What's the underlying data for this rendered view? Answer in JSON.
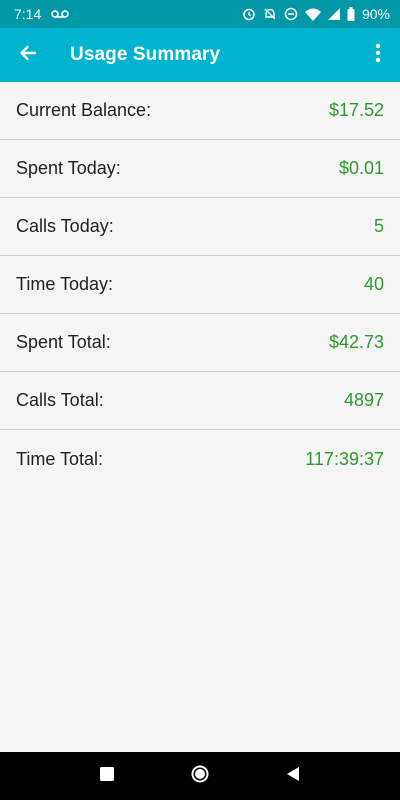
{
  "status_bar": {
    "time": "7:14",
    "battery": "90%",
    "icons": [
      "voicemail-icon",
      "alarm-icon",
      "notifications-off-icon",
      "do-not-disturb-icon",
      "wifi-icon",
      "signal-icon",
      "battery-icon"
    ]
  },
  "app_bar": {
    "title": "Usage Summary",
    "back_icon": "arrow-back-icon",
    "menu_icon": "more-vert-icon"
  },
  "summary": {
    "rows": [
      {
        "label": "Current Balance:",
        "value": "$17.52"
      },
      {
        "label": "Spent Today:",
        "value": "$0.01"
      },
      {
        "label": "Calls Today:",
        "value": "5"
      },
      {
        "label": "Time Today:",
        "value": "40"
      },
      {
        "label": "Spent Total:",
        "value": "$42.73"
      },
      {
        "label": "Calls Total:",
        "value": "4897"
      },
      {
        "label": "Time Total:",
        "value": "117:39:37"
      }
    ]
  },
  "colors": {
    "status_bar": "#0097a7",
    "app_bar": "#00b4d0",
    "value_text": "#2e9a2e",
    "background": "#f5f5f5"
  },
  "nav_bar": {
    "icons": [
      "recents-icon",
      "home-icon",
      "back-icon"
    ]
  }
}
